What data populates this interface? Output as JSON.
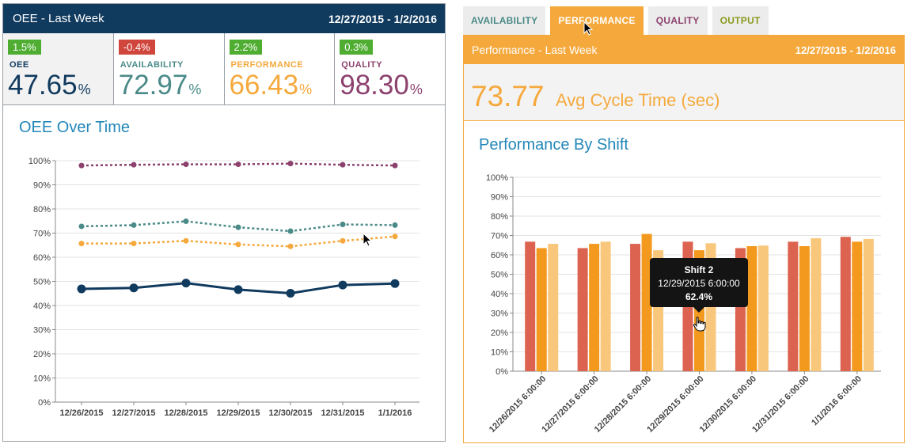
{
  "colors": {
    "navy": "#103a5e",
    "teal": "#4a8a88",
    "orange": "#f5a93d",
    "purple": "#8c416e",
    "green_badge": "#4fae32",
    "red_badge": "#d0463d",
    "title_blue": "#2387b8",
    "bar_red": "#dc6350",
    "bar_orange": "#f39a1e",
    "bar_light": "#f9c77c"
  },
  "left": {
    "header": {
      "title": "OEE - Last Week",
      "dates": "12/27/2015 - 1/2/2016"
    },
    "kpis": [
      {
        "badge": "1.5%",
        "badge_color": "green",
        "label": "OEE",
        "value": "47.65",
        "unit": "%",
        "color": "#103a5e"
      },
      {
        "badge": "-0.4%",
        "badge_color": "red",
        "label": "AVAILABILITY",
        "value": "72.97",
        "unit": "%",
        "color": "#4a8a88"
      },
      {
        "badge": "2.2%",
        "badge_color": "green",
        "label": "PERFORMANCE",
        "value": "66.43",
        "unit": "%",
        "color": "#f5a93d"
      },
      {
        "badge": "0.3%",
        "badge_color": "green",
        "label": "QUALITY",
        "value": "98.30",
        "unit": "%",
        "color": "#8c416e"
      }
    ]
  },
  "right": {
    "tabs": [
      {
        "label": "AVAILABILITY",
        "color": "#4a8a88",
        "active": false
      },
      {
        "label": "PERFORMANCE",
        "color": "#ffffff",
        "active": true
      },
      {
        "label": "QUALITY",
        "color": "#8c416e",
        "active": false
      },
      {
        "label": "OUTPUT",
        "color": "#8a9a1c",
        "active": false
      }
    ],
    "header": {
      "title": "Performance - Last Week",
      "dates": "12/27/2015 - 1/2/2016"
    },
    "avg": {
      "value": "73.77",
      "label": "Avg Cycle Time (sec)"
    },
    "tooltip": {
      "title": "Shift 2",
      "date": "12/29/2015 6:00:00",
      "value": "62.4%"
    }
  },
  "chart_data": [
    {
      "type": "line",
      "title": "OEE Over Time",
      "categories": [
        "12/26/2015",
        "12/27/2015",
        "12/28/2015",
        "12/29/2015",
        "12/30/2015",
        "12/31/2015",
        "1/1/2016"
      ],
      "ylim": [
        0,
        100
      ],
      "yticks": [
        "0%",
        "10%",
        "20%",
        "30%",
        "40%",
        "50%",
        "60%",
        "70%",
        "80%",
        "90%",
        "100%"
      ],
      "grid": true,
      "series": [
        {
          "key": "quality",
          "color": "#8c416e",
          "dashed": true,
          "values": [
            98.0,
            98.3,
            98.5,
            98.5,
            98.8,
            98.3,
            98.0
          ]
        },
        {
          "key": "availability",
          "color": "#4a8a88",
          "dashed": true,
          "values": [
            72.8,
            73.3,
            74.9,
            72.4,
            70.8,
            73.6,
            73.3
          ]
        },
        {
          "key": "performance",
          "color": "#f5a93d",
          "dashed": true,
          "values": [
            65.7,
            65.7,
            66.8,
            65.3,
            64.5,
            66.8,
            68.6
          ]
        },
        {
          "key": "oee",
          "color": "#103a5e",
          "dashed": false,
          "values": [
            46.9,
            47.3,
            49.3,
            46.6,
            45.1,
            48.5,
            49.1
          ]
        }
      ]
    },
    {
      "type": "bar",
      "title": "Performance By Shift",
      "categories": [
        "12/26/2015 6:00:00",
        "12/27/2015 6:00:00",
        "12/28/2015 6:00:00",
        "12/29/2015 6:00:00",
        "12/30/2015 6:00:00",
        "12/31/2015 6:00:00",
        "1/1/2016 6:00:00"
      ],
      "ylim": [
        0,
        100
      ],
      "yticks": [
        "0%",
        "10%",
        "20%",
        "30%",
        "40%",
        "50%",
        "60%",
        "70%",
        "80%",
        "90%",
        "100%"
      ],
      "grid": true,
      "series": [
        {
          "key": "shift1",
          "color": "#dc6350",
          "values": [
            66.8,
            63.5,
            65.7,
            66.8,
            63.5,
            66.8,
            69.3
          ]
        },
        {
          "key": "shift2",
          "color": "#f39a1e",
          "values": [
            63.5,
            65.7,
            70.8,
            62.4,
            64.5,
            64.5,
            66.8
          ]
        },
        {
          "key": "shift3",
          "color": "#f9c77c",
          "values": [
            65.7,
            66.8,
            62.4,
            66.0,
            64.8,
            68.6,
            68.2
          ]
        }
      ]
    }
  ]
}
